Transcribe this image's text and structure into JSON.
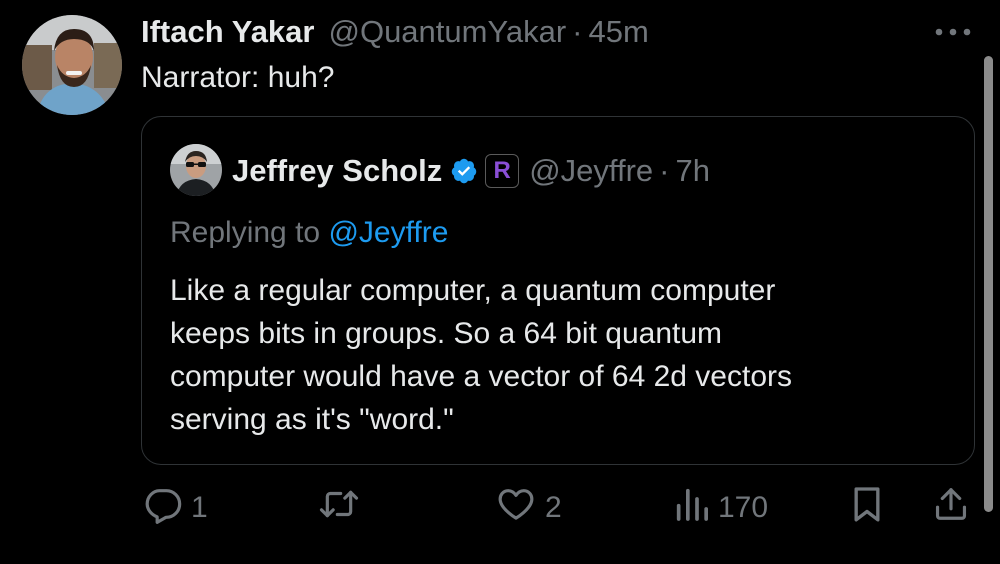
{
  "tweet": {
    "author_name": "Iftach Yakar",
    "author_handle": "@QuantumYakar",
    "separator": "·",
    "time": "45m",
    "text": "Narrator: huh?"
  },
  "quote": {
    "author_name": "Jeffrey Scholz",
    "affiliate_badge": "R",
    "author_handle": "@Jeyffre",
    "separator": "·",
    "time": "7h",
    "replying_prefix": "Replying to",
    "replying_to": "@Jeyffre",
    "text_lines": [
      "Like a regular computer, a quantum computer",
      "keeps bits in groups. So a 64 bit quantum",
      "computer would have a vector of 64 2d vectors",
      "serving as it's \"word.\""
    ]
  },
  "actions": {
    "replies": "1",
    "reposts": "",
    "likes": "2",
    "views": "170"
  },
  "icons": {
    "more": "more-icon",
    "verified": "verified-badge-icon",
    "reply": "reply-icon",
    "repost": "repost-icon",
    "like": "heart-icon",
    "views": "views-icon",
    "bookmark": "bookmark-icon",
    "share": "share-icon"
  },
  "colors": {
    "background": "#000000",
    "primary_text": "#e7e9ea",
    "secondary_text": "#71767b",
    "link": "#1d9bf0",
    "verified": "#1d9bf0",
    "border": "#2f3336"
  }
}
